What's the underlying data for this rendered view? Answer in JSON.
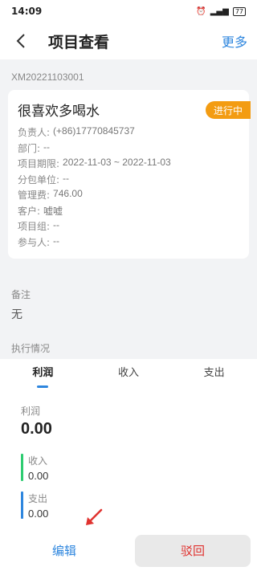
{
  "status_bar": {
    "time": "14:09",
    "battery": "77"
  },
  "nav": {
    "title": "项目查看",
    "more": "更多"
  },
  "project": {
    "code": "XM20221103001",
    "name": "很喜欢多喝水",
    "status": "进行中",
    "status_color": "#f39c12",
    "fields": [
      {
        "label": "负责人:",
        "value": "(+86)17770845737"
      },
      {
        "label": "部门:",
        "value": "--"
      },
      {
        "label": "项目期限:",
        "value": "2022-11-03 ~ 2022-11-03"
      },
      {
        "label": "分包单位:",
        "value": "--"
      },
      {
        "label": "管理费:",
        "value": "746.00"
      },
      {
        "label": "客户:",
        "value": "嘘嘘"
      },
      {
        "label": "项目组:",
        "value": "--"
      },
      {
        "label": "参与人:",
        "value": "--"
      }
    ]
  },
  "remark": {
    "label": "备注",
    "value": "无"
  },
  "execution": {
    "label": "执行情况",
    "tabs": [
      "利润",
      "收入",
      "支出"
    ],
    "active_tab": "利润",
    "profit_label": "利润",
    "profit_value": "0.00",
    "income_label": "收入",
    "income_value": "0.00",
    "income_color": "#2ecc71",
    "expense_label": "支出",
    "expense_value": "0.00",
    "expense_color": "#2e86de"
  },
  "actions": {
    "edit": "编辑",
    "reject": "驳回"
  }
}
